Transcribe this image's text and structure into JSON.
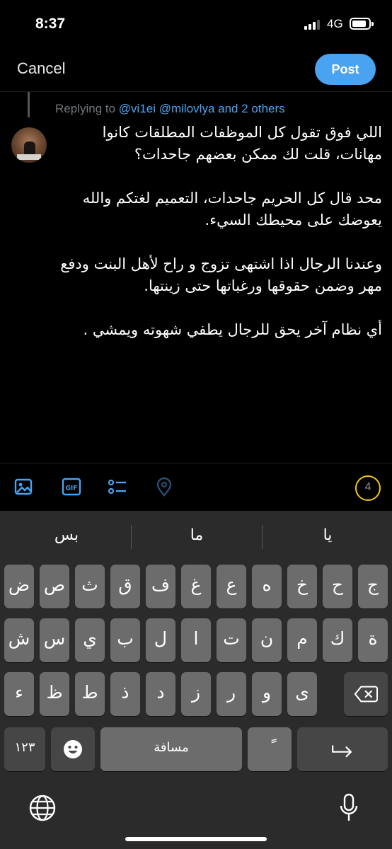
{
  "status_bar": {
    "time": "8:37",
    "network": "4G"
  },
  "header": {
    "cancel_label": "Cancel",
    "post_label": "Post"
  },
  "reply": {
    "prefix": "Replying to",
    "handles": "@vi1ei @milovlya and 2 others"
  },
  "tweet": {
    "paragraphs": [
      "اللي فوق تقول كل الموظفات المطلقات كانوا مهانات، قلت لك ممكن بعضهم جاحدات؟",
      "محد قال كل الحريم جاحدات، التعميم لغتكم والله يعوضك على محيطك السيء.",
      "وعندنا الرجال اذا اشتهى تزوج و راح لأهل البنت ودفع مهر وضمن حقوقها ورغباتها حتى زينتها.",
      "أي نظام آخر يحق للرجال يطفي شهوته ويمشي ."
    ]
  },
  "toolbar": {
    "icons": [
      "image-icon",
      "gif-icon",
      "poll-icon",
      "location-icon"
    ],
    "char_count": "4"
  },
  "colors": {
    "accent": "#4aa3f0",
    "counter_ring": "#f5c518",
    "background": "#000000",
    "keyboard_bg": "#2b2b2b"
  },
  "keyboard": {
    "suggestions": [
      "بس",
      "ما",
      "يا"
    ],
    "row1": [
      "ض",
      "ص",
      "ث",
      "ق",
      "ف",
      "غ",
      "ع",
      "ه",
      "خ",
      "ح",
      "ج"
    ],
    "row2": [
      "ش",
      "س",
      "ي",
      "ب",
      "ل",
      "ا",
      "ت",
      "ن",
      "م",
      "ك",
      "ة"
    ],
    "row3": [
      "ء",
      "ظ",
      "ط",
      "ذ",
      "د",
      "ز",
      "ر",
      "و",
      "ى"
    ],
    "numbers_label": "١٢٣",
    "space_label": "مسافة",
    "tanween_label": "ً"
  }
}
